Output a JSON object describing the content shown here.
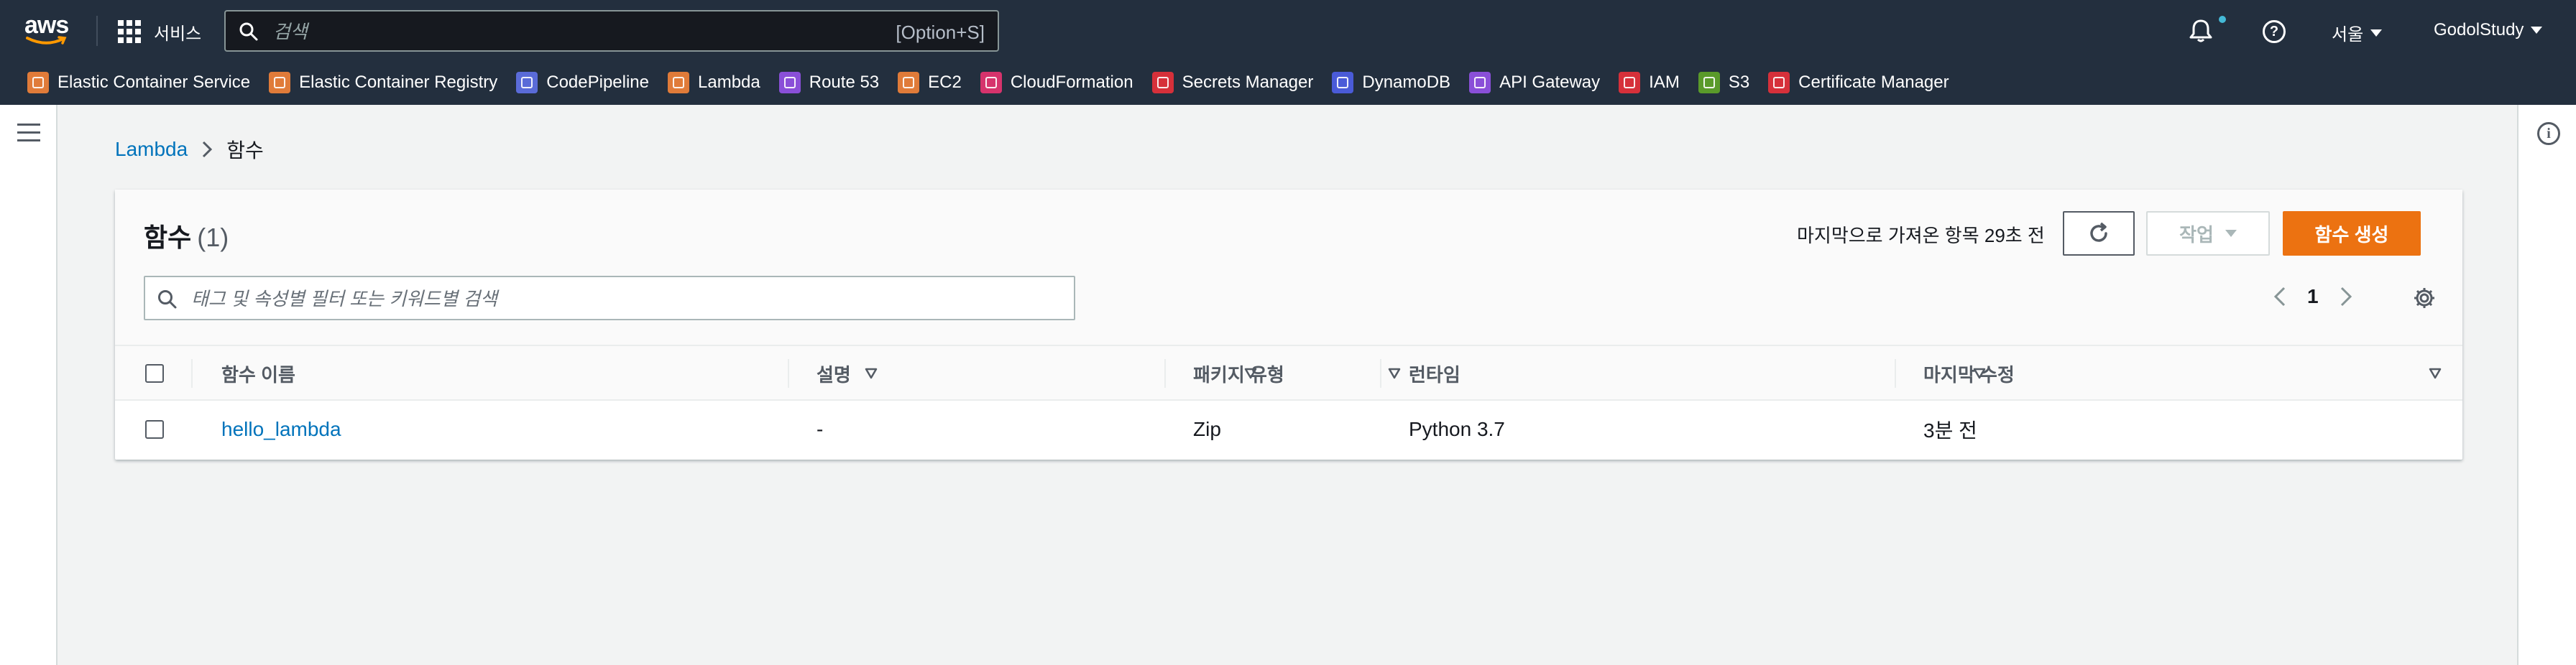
{
  "topnav": {
    "logo_text": "aws",
    "services_label": "서비스",
    "search_placeholder": "검색",
    "search_shortcut": "[Option+S]",
    "region_label": "서울",
    "user_label": "GodolStudy",
    "favorites": [
      {
        "label": "Elastic Container Service",
        "color": "#e07b39",
        "icon": "ecs-icon"
      },
      {
        "label": "Elastic Container Registry",
        "color": "#e07b39",
        "icon": "ecr-icon"
      },
      {
        "label": "CodePipeline",
        "color": "#5a6bd8",
        "icon": "codepipeline-icon"
      },
      {
        "label": "Lambda",
        "color": "#e07b39",
        "icon": "lambda-icon"
      },
      {
        "label": "Route 53",
        "color": "#8a4fd8",
        "icon": "route53-icon"
      },
      {
        "label": "EC2",
        "color": "#e07b39",
        "icon": "ec2-icon"
      },
      {
        "label": "CloudFormation",
        "color": "#d6336c",
        "icon": "cloudformation-icon"
      },
      {
        "label": "Secrets Manager",
        "color": "#d6303a",
        "icon": "secrets-manager-icon"
      },
      {
        "label": "DynamoDB",
        "color": "#4a5bd8",
        "icon": "dynamodb-icon"
      },
      {
        "label": "API Gateway",
        "color": "#8a4fd8",
        "icon": "api-gateway-icon"
      },
      {
        "label": "IAM",
        "color": "#d6303a",
        "icon": "iam-icon"
      },
      {
        "label": "S3",
        "color": "#5a9a2a",
        "icon": "s3-icon"
      },
      {
        "label": "Certificate Manager",
        "color": "#d6303a",
        "icon": "certificate-manager-icon"
      }
    ]
  },
  "breadcrumb": {
    "root": "Lambda",
    "current": "함수"
  },
  "panel": {
    "title": "함수",
    "count": "(1)",
    "last_fetched": "마지막으로 가져온 항목 29초 전",
    "actions_label": "작업",
    "create_label": "함수 생성",
    "filter_placeholder": "태그 및 속성별 필터 또는 키워드별 검색",
    "page_number": "1"
  },
  "table": {
    "columns": [
      "함수 이름",
      "설명",
      "패키지 유형",
      "런타임",
      "마지막 수정"
    ],
    "rows": [
      {
        "name": "hello_lambda",
        "description": "-",
        "package_type": "Zip",
        "runtime": "Python 3.7",
        "last_modified": "3분 전"
      }
    ]
  },
  "colors": {
    "nav_bg": "#232f3e",
    "accent_orange": "#ec7211",
    "link_blue": "#0073bb"
  }
}
